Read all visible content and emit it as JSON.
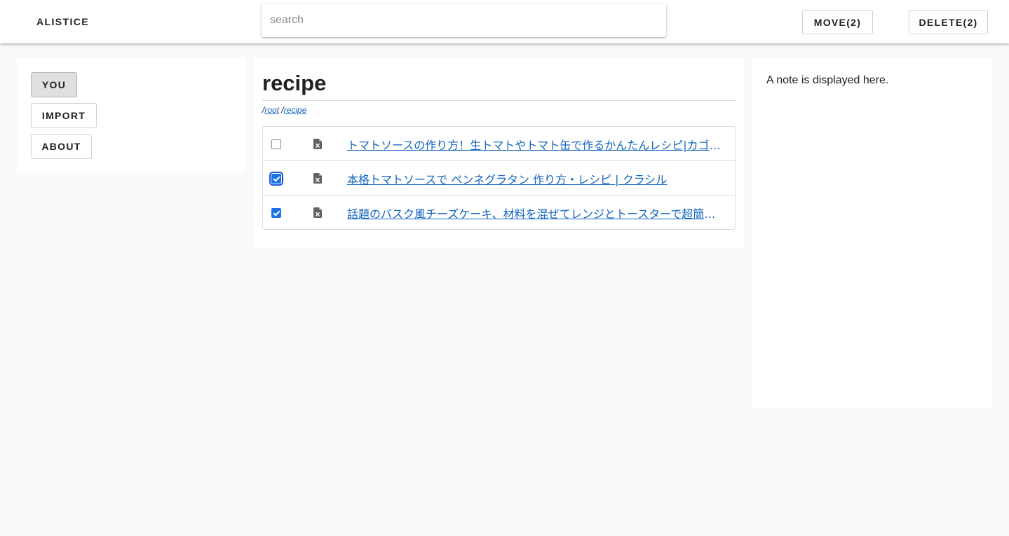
{
  "header": {
    "brand": "ALISTICE",
    "search_placeholder": "search",
    "move_label": "MOVE(2)",
    "delete_label": "DELETE(2)"
  },
  "sidebar": {
    "items": [
      {
        "label": "YOU",
        "active": true
      },
      {
        "label": "IMPORT",
        "active": false
      },
      {
        "label": "ABOUT",
        "active": false
      }
    ]
  },
  "main": {
    "title": "recipe",
    "breadcrumb": [
      {
        "separator": "/",
        "label": "root"
      },
      {
        "separator": "/",
        "label": "recipe"
      }
    ],
    "rows": [
      {
        "checked": false,
        "icon": "file-document-icon",
        "title": "トマトソースの作り方！生トマトやトマト缶で作るかんたんレシピ|カゴメ株式会社"
      },
      {
        "checked": true,
        "icon": "file-document-icon",
        "title": "本格トマトソースで ペンネグラタン 作り方・レシピ | クラシル"
      },
      {
        "checked": true,
        "icon": "file-document-icon",
        "title": "話題のバスク風チーズケーキ、材料を混ぜてレンジとトースターで超簡単に作れちゃう"
      }
    ]
  },
  "note": {
    "text": "A note is displayed here."
  },
  "colors": {
    "accent": "#1a73e8",
    "link": "#1565c0",
    "background": "#fafafa",
    "active_nav": "#e0e0e0"
  }
}
